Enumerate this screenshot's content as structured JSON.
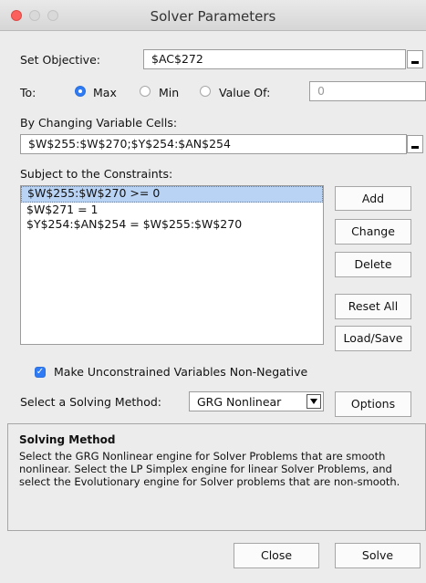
{
  "window": {
    "title": "Solver Parameters"
  },
  "objective": {
    "label": "Set Objective:",
    "value": "$AC$272"
  },
  "to": {
    "label": "To:",
    "options": [
      "Max",
      "Min",
      "Value Of:"
    ],
    "selected": "Max",
    "value_of": "0"
  },
  "variables": {
    "label": "By Changing Variable Cells:",
    "value": "$W$255:$W$270;$Y$254:$AN$254"
  },
  "constraints": {
    "label": "Subject to the Constraints:",
    "items": [
      "$W$255:$W$270 >= 0",
      "$W$271 = 1",
      "$Y$254:$AN$254 = $W$255:$W$270"
    ],
    "selected_index": 0
  },
  "buttons": {
    "add": "Add",
    "change": "Change",
    "delete": "Delete",
    "reset_all": "Reset All",
    "load_save": "Load/Save",
    "options": "Options",
    "close": "Close",
    "solve": "Solve"
  },
  "nonneg": {
    "label": "Make Unconstrained Variables Non-Negative",
    "checked": true
  },
  "method": {
    "label": "Select a Solving Method:",
    "value": "GRG Nonlinear"
  },
  "info": {
    "title": "Solving Method",
    "text": "Select the GRG Nonlinear engine for Solver Problems that are smooth nonlinear. Select the LP Simplex engine for linear Solver Problems, and select the Evolutionary engine for Solver problems that are non-smooth."
  },
  "colors": {
    "accent": "#2f7bf6",
    "selection": "#b9d3f5",
    "close_light": "#fc605c"
  }
}
